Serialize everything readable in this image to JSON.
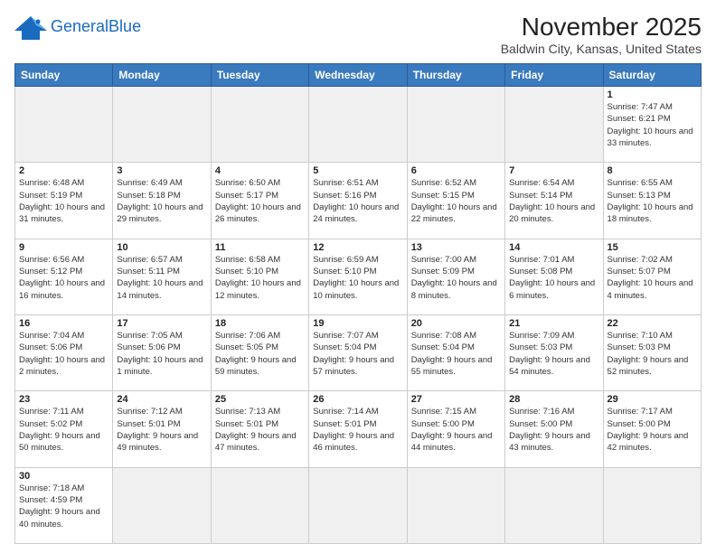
{
  "header": {
    "logo_general": "General",
    "logo_blue": "Blue",
    "title": "November 2025",
    "subtitle": "Baldwin City, Kansas, United States"
  },
  "weekdays": [
    "Sunday",
    "Monday",
    "Tuesday",
    "Wednesday",
    "Thursday",
    "Friday",
    "Saturday"
  ],
  "weeks": [
    [
      {
        "day": "",
        "info": ""
      },
      {
        "day": "",
        "info": ""
      },
      {
        "day": "",
        "info": ""
      },
      {
        "day": "",
        "info": ""
      },
      {
        "day": "",
        "info": ""
      },
      {
        "day": "",
        "info": ""
      },
      {
        "day": "1",
        "info": "Sunrise: 7:47 AM\nSunset: 6:21 PM\nDaylight: 10 hours and 33 minutes."
      }
    ],
    [
      {
        "day": "2",
        "info": "Sunrise: 6:48 AM\nSunset: 5:19 PM\nDaylight: 10 hours and 31 minutes."
      },
      {
        "day": "3",
        "info": "Sunrise: 6:49 AM\nSunset: 5:18 PM\nDaylight: 10 hours and 29 minutes."
      },
      {
        "day": "4",
        "info": "Sunrise: 6:50 AM\nSunset: 5:17 PM\nDaylight: 10 hours and 26 minutes."
      },
      {
        "day": "5",
        "info": "Sunrise: 6:51 AM\nSunset: 5:16 PM\nDaylight: 10 hours and 24 minutes."
      },
      {
        "day": "6",
        "info": "Sunrise: 6:52 AM\nSunset: 5:15 PM\nDaylight: 10 hours and 22 minutes."
      },
      {
        "day": "7",
        "info": "Sunrise: 6:54 AM\nSunset: 5:14 PM\nDaylight: 10 hours and 20 minutes."
      },
      {
        "day": "8",
        "info": "Sunrise: 6:55 AM\nSunset: 5:13 PM\nDaylight: 10 hours and 18 minutes."
      }
    ],
    [
      {
        "day": "9",
        "info": "Sunrise: 6:56 AM\nSunset: 5:12 PM\nDaylight: 10 hours and 16 minutes."
      },
      {
        "day": "10",
        "info": "Sunrise: 6:57 AM\nSunset: 5:11 PM\nDaylight: 10 hours and 14 minutes."
      },
      {
        "day": "11",
        "info": "Sunrise: 6:58 AM\nSunset: 5:10 PM\nDaylight: 10 hours and 12 minutes."
      },
      {
        "day": "12",
        "info": "Sunrise: 6:59 AM\nSunset: 5:10 PM\nDaylight: 10 hours and 10 minutes."
      },
      {
        "day": "13",
        "info": "Sunrise: 7:00 AM\nSunset: 5:09 PM\nDaylight: 10 hours and 8 minutes."
      },
      {
        "day": "14",
        "info": "Sunrise: 7:01 AM\nSunset: 5:08 PM\nDaylight: 10 hours and 6 minutes."
      },
      {
        "day": "15",
        "info": "Sunrise: 7:02 AM\nSunset: 5:07 PM\nDaylight: 10 hours and 4 minutes."
      }
    ],
    [
      {
        "day": "16",
        "info": "Sunrise: 7:04 AM\nSunset: 5:06 PM\nDaylight: 10 hours and 2 minutes."
      },
      {
        "day": "17",
        "info": "Sunrise: 7:05 AM\nSunset: 5:06 PM\nDaylight: 10 hours and 1 minute."
      },
      {
        "day": "18",
        "info": "Sunrise: 7:06 AM\nSunset: 5:05 PM\nDaylight: 9 hours and 59 minutes."
      },
      {
        "day": "19",
        "info": "Sunrise: 7:07 AM\nSunset: 5:04 PM\nDaylight: 9 hours and 57 minutes."
      },
      {
        "day": "20",
        "info": "Sunrise: 7:08 AM\nSunset: 5:04 PM\nDaylight: 9 hours and 55 minutes."
      },
      {
        "day": "21",
        "info": "Sunrise: 7:09 AM\nSunset: 5:03 PM\nDaylight: 9 hours and 54 minutes."
      },
      {
        "day": "22",
        "info": "Sunrise: 7:10 AM\nSunset: 5:03 PM\nDaylight: 9 hours and 52 minutes."
      }
    ],
    [
      {
        "day": "23",
        "info": "Sunrise: 7:11 AM\nSunset: 5:02 PM\nDaylight: 9 hours and 50 minutes."
      },
      {
        "day": "24",
        "info": "Sunrise: 7:12 AM\nSunset: 5:01 PM\nDaylight: 9 hours and 49 minutes."
      },
      {
        "day": "25",
        "info": "Sunrise: 7:13 AM\nSunset: 5:01 PM\nDaylight: 9 hours and 47 minutes."
      },
      {
        "day": "26",
        "info": "Sunrise: 7:14 AM\nSunset: 5:01 PM\nDaylight: 9 hours and 46 minutes."
      },
      {
        "day": "27",
        "info": "Sunrise: 7:15 AM\nSunset: 5:00 PM\nDaylight: 9 hours and 44 minutes."
      },
      {
        "day": "28",
        "info": "Sunrise: 7:16 AM\nSunset: 5:00 PM\nDaylight: 9 hours and 43 minutes."
      },
      {
        "day": "29",
        "info": "Sunrise: 7:17 AM\nSunset: 5:00 PM\nDaylight: 9 hours and 42 minutes."
      }
    ],
    [
      {
        "day": "30",
        "info": "Sunrise: 7:18 AM\nSunset: 4:59 PM\nDaylight: 9 hours and 40 minutes."
      },
      {
        "day": "",
        "info": ""
      },
      {
        "day": "",
        "info": ""
      },
      {
        "day": "",
        "info": ""
      },
      {
        "day": "",
        "info": ""
      },
      {
        "day": "",
        "info": ""
      },
      {
        "day": "",
        "info": ""
      }
    ]
  ]
}
